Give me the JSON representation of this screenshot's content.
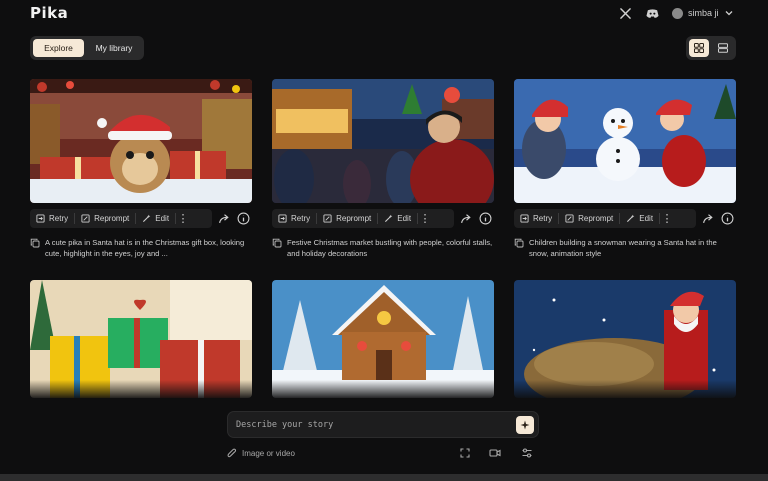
{
  "app": {
    "logo": "Pika"
  },
  "topbar": {
    "icons": [
      "x-logo-icon",
      "discord-icon"
    ],
    "user": {
      "name": "simba ji",
      "menu_icon": "chevron-down-icon"
    }
  },
  "tabs": {
    "explore": "Explore",
    "library": "My library",
    "active": "Explore"
  },
  "view_toggle": {
    "active": "grid-view-icon",
    "other": "list-view-icon"
  },
  "card_actions": {
    "retry": "Retry",
    "reprompt": "Reprompt",
    "edit": "Edit"
  },
  "cards": [
    {
      "prompt": "A cute pika in Santa hat is in the Christmas gift box, looking cute, highlight in the eyes, joy and ..."
    },
    {
      "prompt": "Festive Christmas market bustling with people, colorful stalls, and holiday decorations"
    },
    {
      "prompt": "Children building a snowman wearing a Santa hat in the snow, animation style"
    },
    {
      "prompt": ""
    },
    {
      "prompt": ""
    },
    {
      "prompt": ""
    }
  ],
  "composer": {
    "placeholder": "Describe your story",
    "submit_icon": "sparkle-icon",
    "attach_label": "Image or video",
    "tools": [
      "expand-icon",
      "camera-icon",
      "settings-sliders-icon"
    ]
  },
  "colors": {
    "accent": "#f6e9d7",
    "background": "#0e0e0f",
    "surface": "#2a2a2b"
  }
}
